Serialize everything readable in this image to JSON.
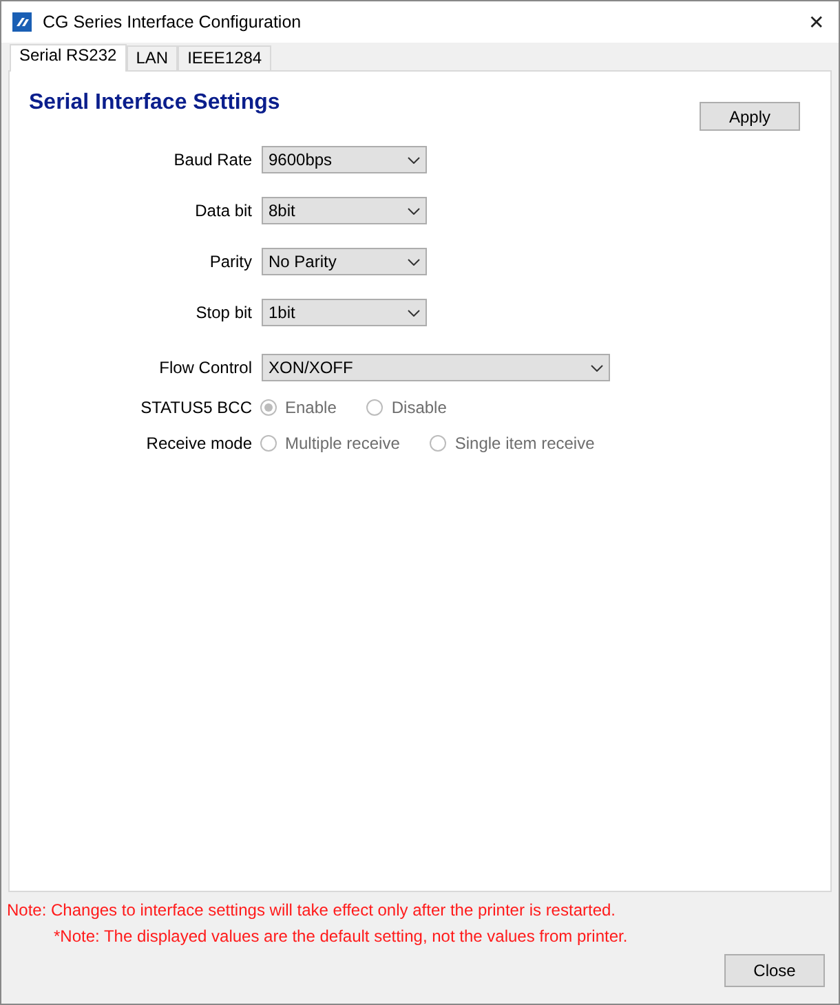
{
  "window": {
    "title": "CG Series Interface Configuration",
    "close": "✕"
  },
  "tabs": [
    {
      "label": "Serial RS232",
      "selected": true
    },
    {
      "label": "LAN",
      "selected": false
    },
    {
      "label": "IEEE1284",
      "selected": false
    }
  ],
  "heading": "Serial Interface Settings",
  "apply_button": "Apply",
  "settings": [
    {
      "kind": "dropdown",
      "label": "Baud Rate",
      "value": "9600bps",
      "wide": false
    },
    {
      "kind": "dropdown",
      "label": "Data bit",
      "value": "8bit",
      "wide": false
    },
    {
      "kind": "dropdown",
      "label": "Parity",
      "value": "No Parity",
      "wide": false
    },
    {
      "kind": "dropdown",
      "label": "Stop bit",
      "value": "1bit",
      "wide": false
    },
    {
      "kind": "dropdown",
      "label": "Flow Control",
      "value": "XON/XOFF",
      "wide": true
    },
    {
      "kind": "radio",
      "label": "STATUS5 BCC",
      "disabled": true,
      "options": [
        {
          "label": "Enable",
          "selected": true
        },
        {
          "label": "Disable",
          "selected": false
        }
      ]
    },
    {
      "kind": "radio",
      "label": "Receive mode",
      "disabled": true,
      "options": [
        {
          "label": "Multiple receive",
          "selected": false
        },
        {
          "label": "Single item receive",
          "selected": false
        }
      ]
    }
  ],
  "notes": [
    "Note: Changes to interface settings will take effect only after the printer is restarted.",
    "*Note: The displayed values are the default setting, not the values from printer."
  ],
  "close_button": "Close"
}
